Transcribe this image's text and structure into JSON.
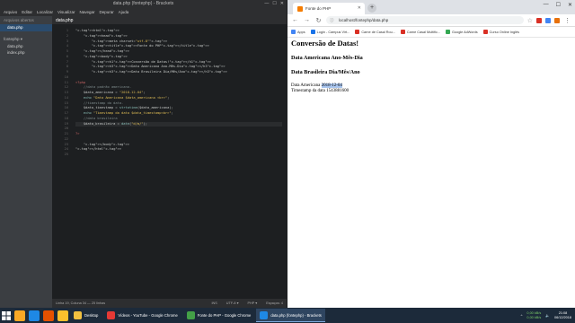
{
  "brackets": {
    "title": "data.php (fontephp) - Brackets",
    "window_controls": [
      "—",
      "☐",
      "✕"
    ],
    "menu": [
      "Arquivo",
      "Editar",
      "Localizar",
      "Visualizar",
      "Navegar",
      "Depurar",
      "Ajuda"
    ],
    "sidebar": {
      "working_files_label": "Arquivos abertos",
      "working_files": [
        "data.php"
      ],
      "project_label": "fontephp ▾",
      "project_files": [
        "data.php",
        "index.php"
      ]
    },
    "tab": "data.php",
    "line_numbers": [
      "1",
      "2",
      "3",
      "4",
      "5",
      "6",
      "7",
      "8",
      "9",
      "10",
      "11",
      "12",
      "13",
      "14",
      "15",
      "16",
      "17",
      "18",
      "19",
      "20",
      "21",
      "22",
      "23",
      "24",
      "25"
    ],
    "code_lines": [
      "<html>",
      "    <head>",
      "        <meta charset=\"utf-8\">",
      "        <title>Fonte do PHP</title>",
      "    </head>",
      "    <body>",
      "        <h1>Conversão de Datas!</h1>",
      "        <h3>Data Americana Ano-Mês-Dia</h3>",
      "        <h3>Data Brasileira Dia/Mês/Ano</h3>",
      "",
      "<?php",
      "    //data padrão americano.",
      "    $data_americana = \"2018-12-04\";",
      "    echo \"Data Americana $data_americana <br>\";",
      "    //timestamp da data.",
      "    $data_timestamp = strtotime($data_americana);",
      "    echo \"Timestamp da data $data_timestamp<br>\";",
      "    //data brasileira",
      "    $data_brasileira = date(\"d/m/\");",
      "",
      "?>",
      "",
      "    </body>",
      "</html>",
      ""
    ],
    "status": {
      "position": "Linha 19, Coluna 34 — 25 linhas",
      "ins": "INS",
      "encoding": "UTF-8 ▾",
      "language": "PHP ▾",
      "indent": "Espaços: 4"
    }
  },
  "chrome": {
    "tab_title": "Fonte do PHP",
    "url": "localhost/fontephp/data.php",
    "bookmarks": [
      {
        "label": "Apps",
        "color": "#4285f4"
      },
      {
        "label": "Login - Campus Virt...",
        "color": "#1a73e8"
      },
      {
        "label": "Carne de Casal Rou...",
        "color": "#d93025"
      },
      {
        "label": "Carne Casal Multific...",
        "color": "#d93025"
      },
      {
        "label": "Google AdWords",
        "color": "#34a853"
      },
      {
        "label": "Curso Online Inglês",
        "color": "#d93025"
      }
    ],
    "page": {
      "h1": "Conversão de Datas!",
      "h3_1": "Data Americana Ano-Mês-Dia",
      "h3_2": "Data Brasileira Dia/Mês/Ano",
      "line1_prefix": "Data Americana ",
      "line1_value": "2018-12-04",
      "line2": "Timestamp da data 1543881600"
    }
  },
  "taskbar": {
    "items": [
      {
        "label": "Desktop",
        "color": "#f0c040",
        "active": false
      },
      {
        "label": "Vídeos - YouTube - Google Chrome",
        "color": "#e53935",
        "active": false
      },
      {
        "label": "Fonte do PHP - Google Chrome",
        "color": "#43a047",
        "active": false
      },
      {
        "label": "data.php (fontephp) - Brackets",
        "color": "#1e88e5",
        "active": true
      }
    ],
    "pinned": [
      "#f9a825",
      "#1e88e5",
      "#e65100",
      "#fbc02d"
    ],
    "net_up": "0,00 kB/s",
    "net_down": "0,00 kB/s",
    "time": "21:08",
    "date": "06/12/2018"
  },
  "colors": {
    "editor_bg": "#1d1f21",
    "sidebar_bg": "#3b3e42",
    "taskbar_bg": "#1c2a3a",
    "selection": "#a9c5ee"
  }
}
